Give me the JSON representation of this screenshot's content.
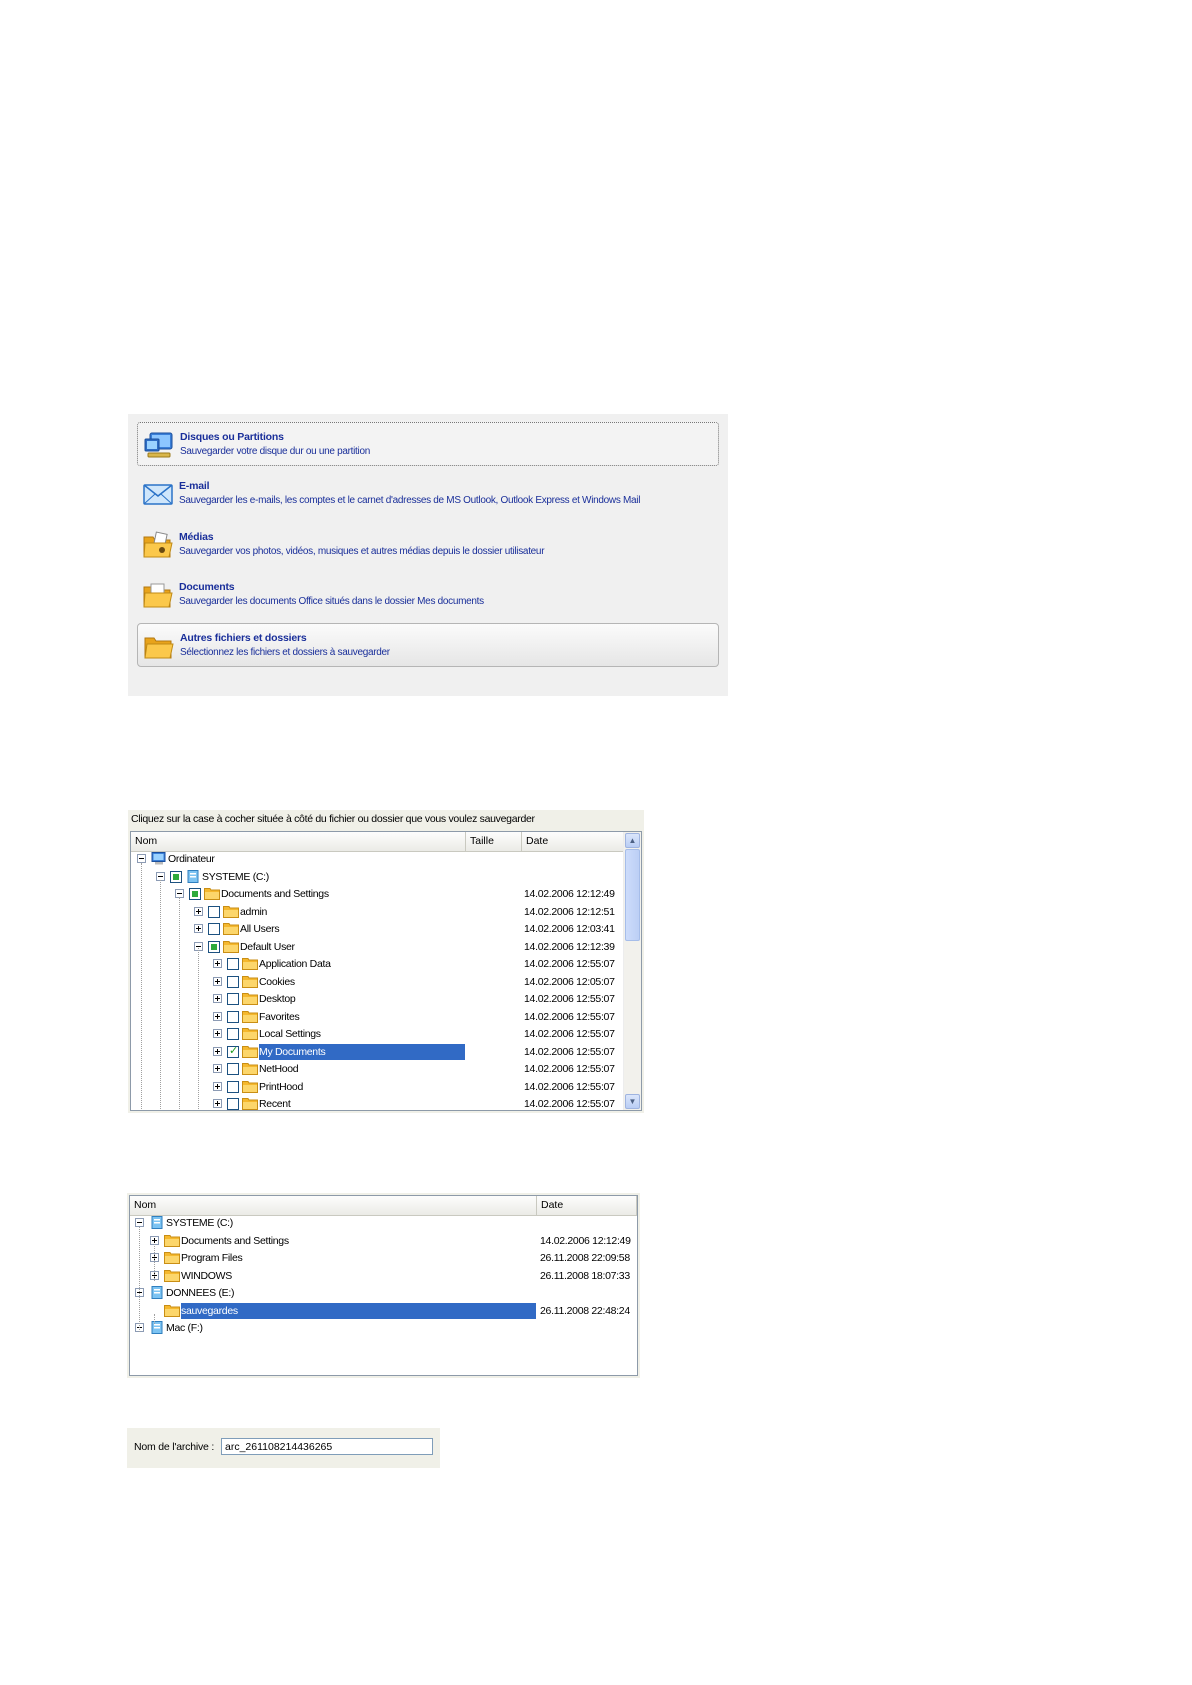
{
  "backup_types": [
    {
      "title": "Disques ou Partitions",
      "desc": "Sauvegarder votre disque dur ou une partition",
      "icon": "monitor-icon",
      "state": "focused"
    },
    {
      "title": "E-mail",
      "desc": "Sauvegarder les e-mails, les comptes et le carnet d'adresses de MS Outlook, Outlook Express et Windows Mail",
      "icon": "envelope-icon",
      "state": "normal"
    },
    {
      "title": "Médias",
      "desc": "Sauvegarder vos photos, vidéos, musiques et autres médias depuis le dossier utilisateur",
      "icon": "media-folder-icon",
      "state": "normal"
    },
    {
      "title": "Documents",
      "desc": "Sauvegarder les documents Office situés dans le dossier Mes documents",
      "icon": "documents-folder-icon",
      "state": "normal"
    },
    {
      "title": "Autres fichiers et dossiers",
      "desc": "Sélectionnez les fichiers et dossiers à sauvegarder",
      "icon": "folder-icon",
      "state": "hover"
    }
  ],
  "file_selector": {
    "instruction": "Cliquez sur la case à cocher située à côté du fichier ou dossier que vous voulez sauvegarder",
    "col_name": "Nom",
    "col_size": "Taille",
    "col_date": "Date",
    "rows": [
      {
        "depth": 0,
        "exp": "minus",
        "cb": "",
        "icon": "computer",
        "name": "Ordinateur",
        "date": ""
      },
      {
        "depth": 1,
        "exp": "minus",
        "cb": "partial",
        "icon": "drive",
        "name": "SYSTEME (C:)",
        "date": ""
      },
      {
        "depth": 2,
        "exp": "minus",
        "cb": "partial",
        "icon": "folder",
        "name": "Documents and Settings",
        "date": "14.02.2006 12:12:49"
      },
      {
        "depth": 3,
        "exp": "plus",
        "cb": "empty",
        "icon": "folder",
        "name": "admin",
        "date": "14.02.2006 12:12:51"
      },
      {
        "depth": 3,
        "exp": "plus",
        "cb": "empty",
        "icon": "folder",
        "name": "All Users",
        "date": "14.02.2006 12:03:41"
      },
      {
        "depth": 3,
        "exp": "minus",
        "cb": "partial",
        "icon": "folder",
        "name": "Default User",
        "date": "14.02.2006 12:12:39"
      },
      {
        "depth": 4,
        "exp": "plus",
        "cb": "empty",
        "icon": "folder",
        "name": "Application Data",
        "date": "14.02.2006 12:55:07"
      },
      {
        "depth": 4,
        "exp": "plus",
        "cb": "empty",
        "icon": "folder",
        "name": "Cookies",
        "date": "14.02.2006 12:05:07"
      },
      {
        "depth": 4,
        "exp": "plus",
        "cb": "empty",
        "icon": "folder",
        "name": "Desktop",
        "date": "14.02.2006 12:55:07"
      },
      {
        "depth": 4,
        "exp": "plus",
        "cb": "empty",
        "icon": "folder",
        "name": "Favorites",
        "date": "14.02.2006 12:55:07"
      },
      {
        "depth": 4,
        "exp": "plus",
        "cb": "empty",
        "icon": "folder",
        "name": "Local Settings",
        "date": "14.02.2006 12:55:07"
      },
      {
        "depth": 4,
        "exp": "plus",
        "cb": "checked",
        "icon": "folder",
        "name": "My Documents",
        "date": "14.02.2006 12:55:07",
        "selected": true
      },
      {
        "depth": 4,
        "exp": "plus",
        "cb": "empty",
        "icon": "folder",
        "name": "NetHood",
        "date": "14.02.2006 12:55:07"
      },
      {
        "depth": 4,
        "exp": "plus",
        "cb": "empty",
        "icon": "folder",
        "name": "PrintHood",
        "date": "14.02.2006 12:55:07"
      },
      {
        "depth": 4,
        "exp": "plus",
        "cb": "empty",
        "icon": "folder",
        "name": "Recent",
        "date": "14.02.2006 12:55:07"
      }
    ]
  },
  "destination_selector": {
    "col_name": "Nom",
    "col_date": "Date",
    "rows": [
      {
        "depth": 0,
        "exp": "minus",
        "icon": "drive",
        "name": "SYSTEME (C:)",
        "date": ""
      },
      {
        "depth": 1,
        "exp": "plus",
        "icon": "folder",
        "name": "Documents and Settings",
        "date": "14.02.2006 12:12:49"
      },
      {
        "depth": 1,
        "exp": "plus",
        "icon": "folder",
        "name": "Program Files",
        "date": "26.11.2008 22:09:58"
      },
      {
        "depth": 1,
        "exp": "plus",
        "icon": "folder",
        "name": "WINDOWS",
        "date": "26.11.2008 18:07:33"
      },
      {
        "depth": 0,
        "exp": "minus",
        "icon": "drive",
        "name": "DONNEES (E:)",
        "date": ""
      },
      {
        "depth": 1,
        "exp": "",
        "icon": "folder",
        "name": "sauvegardes",
        "date": "26.11.2008 22:48:24",
        "selected": true
      },
      {
        "depth": 0,
        "exp": "minus",
        "icon": "drive",
        "name": "Mac (F:)",
        "date": ""
      }
    ]
  },
  "archive": {
    "label": "Nom de l'archive :",
    "value": "arc_261108214436265"
  },
  "colors": {
    "accent_text": "#1a2f9a",
    "selection": "#316ac5",
    "folder": "#f5b82e"
  }
}
